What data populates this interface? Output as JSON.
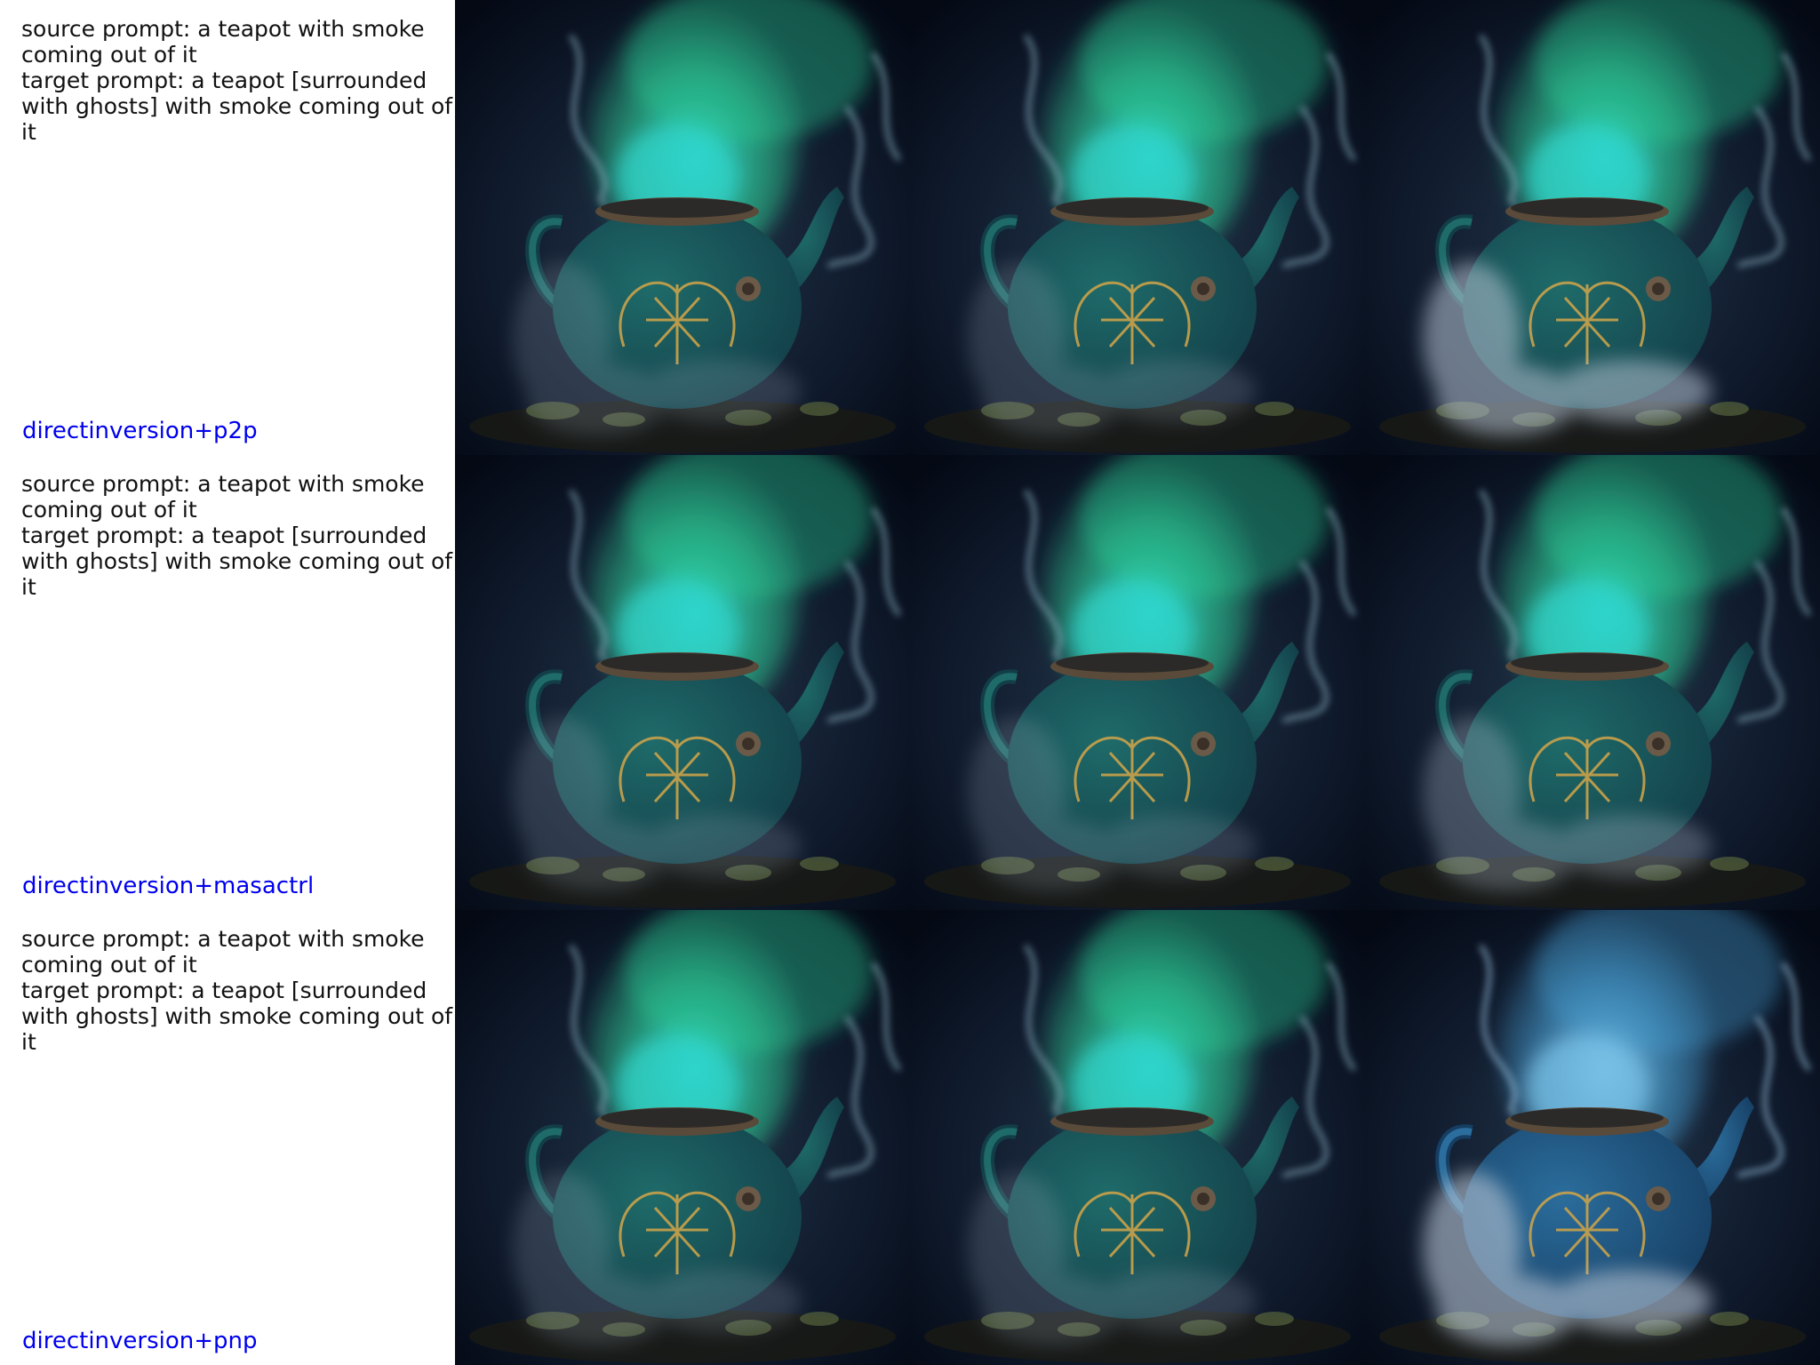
{
  "rows": [
    {
      "source_prompt": "source prompt: a teapot with smoke coming out of it",
      "target_prompt": "target prompt: a teapot [surrounded with ghosts] with smoke coming out of it",
      "method": "directinversion+p2p"
    },
    {
      "source_prompt": "source prompt: a teapot with smoke coming out of it",
      "target_prompt": "target prompt: a teapot [surrounded with ghosts] with smoke coming out of it",
      "method": "directinversion+masactrl"
    },
    {
      "source_prompt": "source prompt: a teapot with smoke coming out of it",
      "target_prompt": "target prompt: a teapot [surrounded with ghosts] with smoke coming out of it",
      "method": "directinversion+pnp"
    }
  ],
  "colors": {
    "method_label": "#0000ee",
    "prompt_text": "#111111",
    "smoke_green": "#2fe0a0",
    "smoke_cyan": "#30d8d0",
    "teapot_teal": "#1f6b6a",
    "ornament_gold": "#c9a24a",
    "ghost_smoke": "#b8c6d6"
  }
}
